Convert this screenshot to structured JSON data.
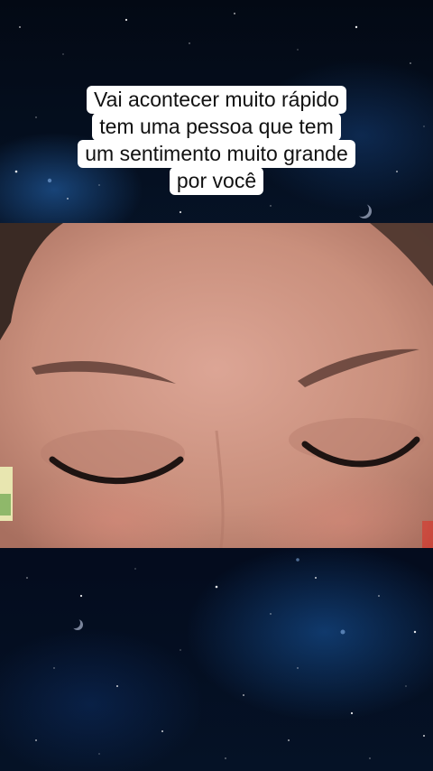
{
  "caption": {
    "lines": [
      "Vai acontecer muito rápido",
      "tem uma pessoa que tem",
      "um sentimento muito grande",
      "por você"
    ]
  },
  "background": {
    "theme": "starry-space",
    "accent": "#2a6fc0"
  },
  "video": {
    "subject": "closed-eyes-face",
    "skin_color": "#c98f7c"
  }
}
